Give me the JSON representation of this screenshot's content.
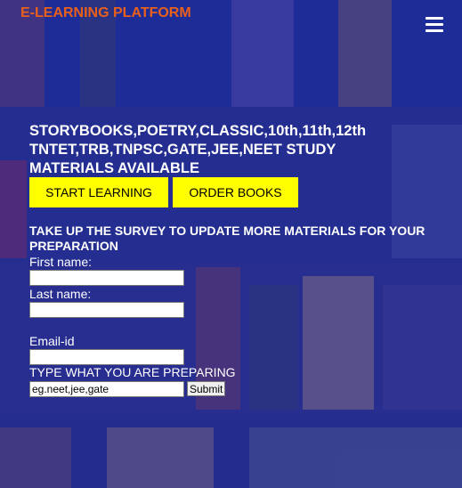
{
  "brand": "E-LEARNING PLATFORM",
  "menu_icon": "hamburger-menu-icon",
  "hero": {
    "headline": "STORYBOOKS,POETRY,CLASSIC,10th,11th,12th TNTET,TRB,TNPSC,GATE,JEE,NEET STUDY MATERIALS AVAILABLE",
    "start_button": "START LEARNING",
    "order_button": "ORDER BOOKS"
  },
  "survey": {
    "title": "TAKE UP THE SURVEY TO UPDATE MORE MATERIALS FOR YOUR PREPARATION",
    "first_name_label": "First name:",
    "first_name_value": "",
    "last_name_label": "Last name:",
    "last_name_value": "",
    "email_label": "Email-id",
    "email_value": "",
    "preparing_label": "TYPE WHAT YOU ARE PREPARING",
    "preparing_value": "eg.neet,jee,gate",
    "submit_label": "Submit"
  },
  "colors": {
    "brand": "#e8601c",
    "button": "#ffff00",
    "overlay": "#1e2dbe"
  }
}
